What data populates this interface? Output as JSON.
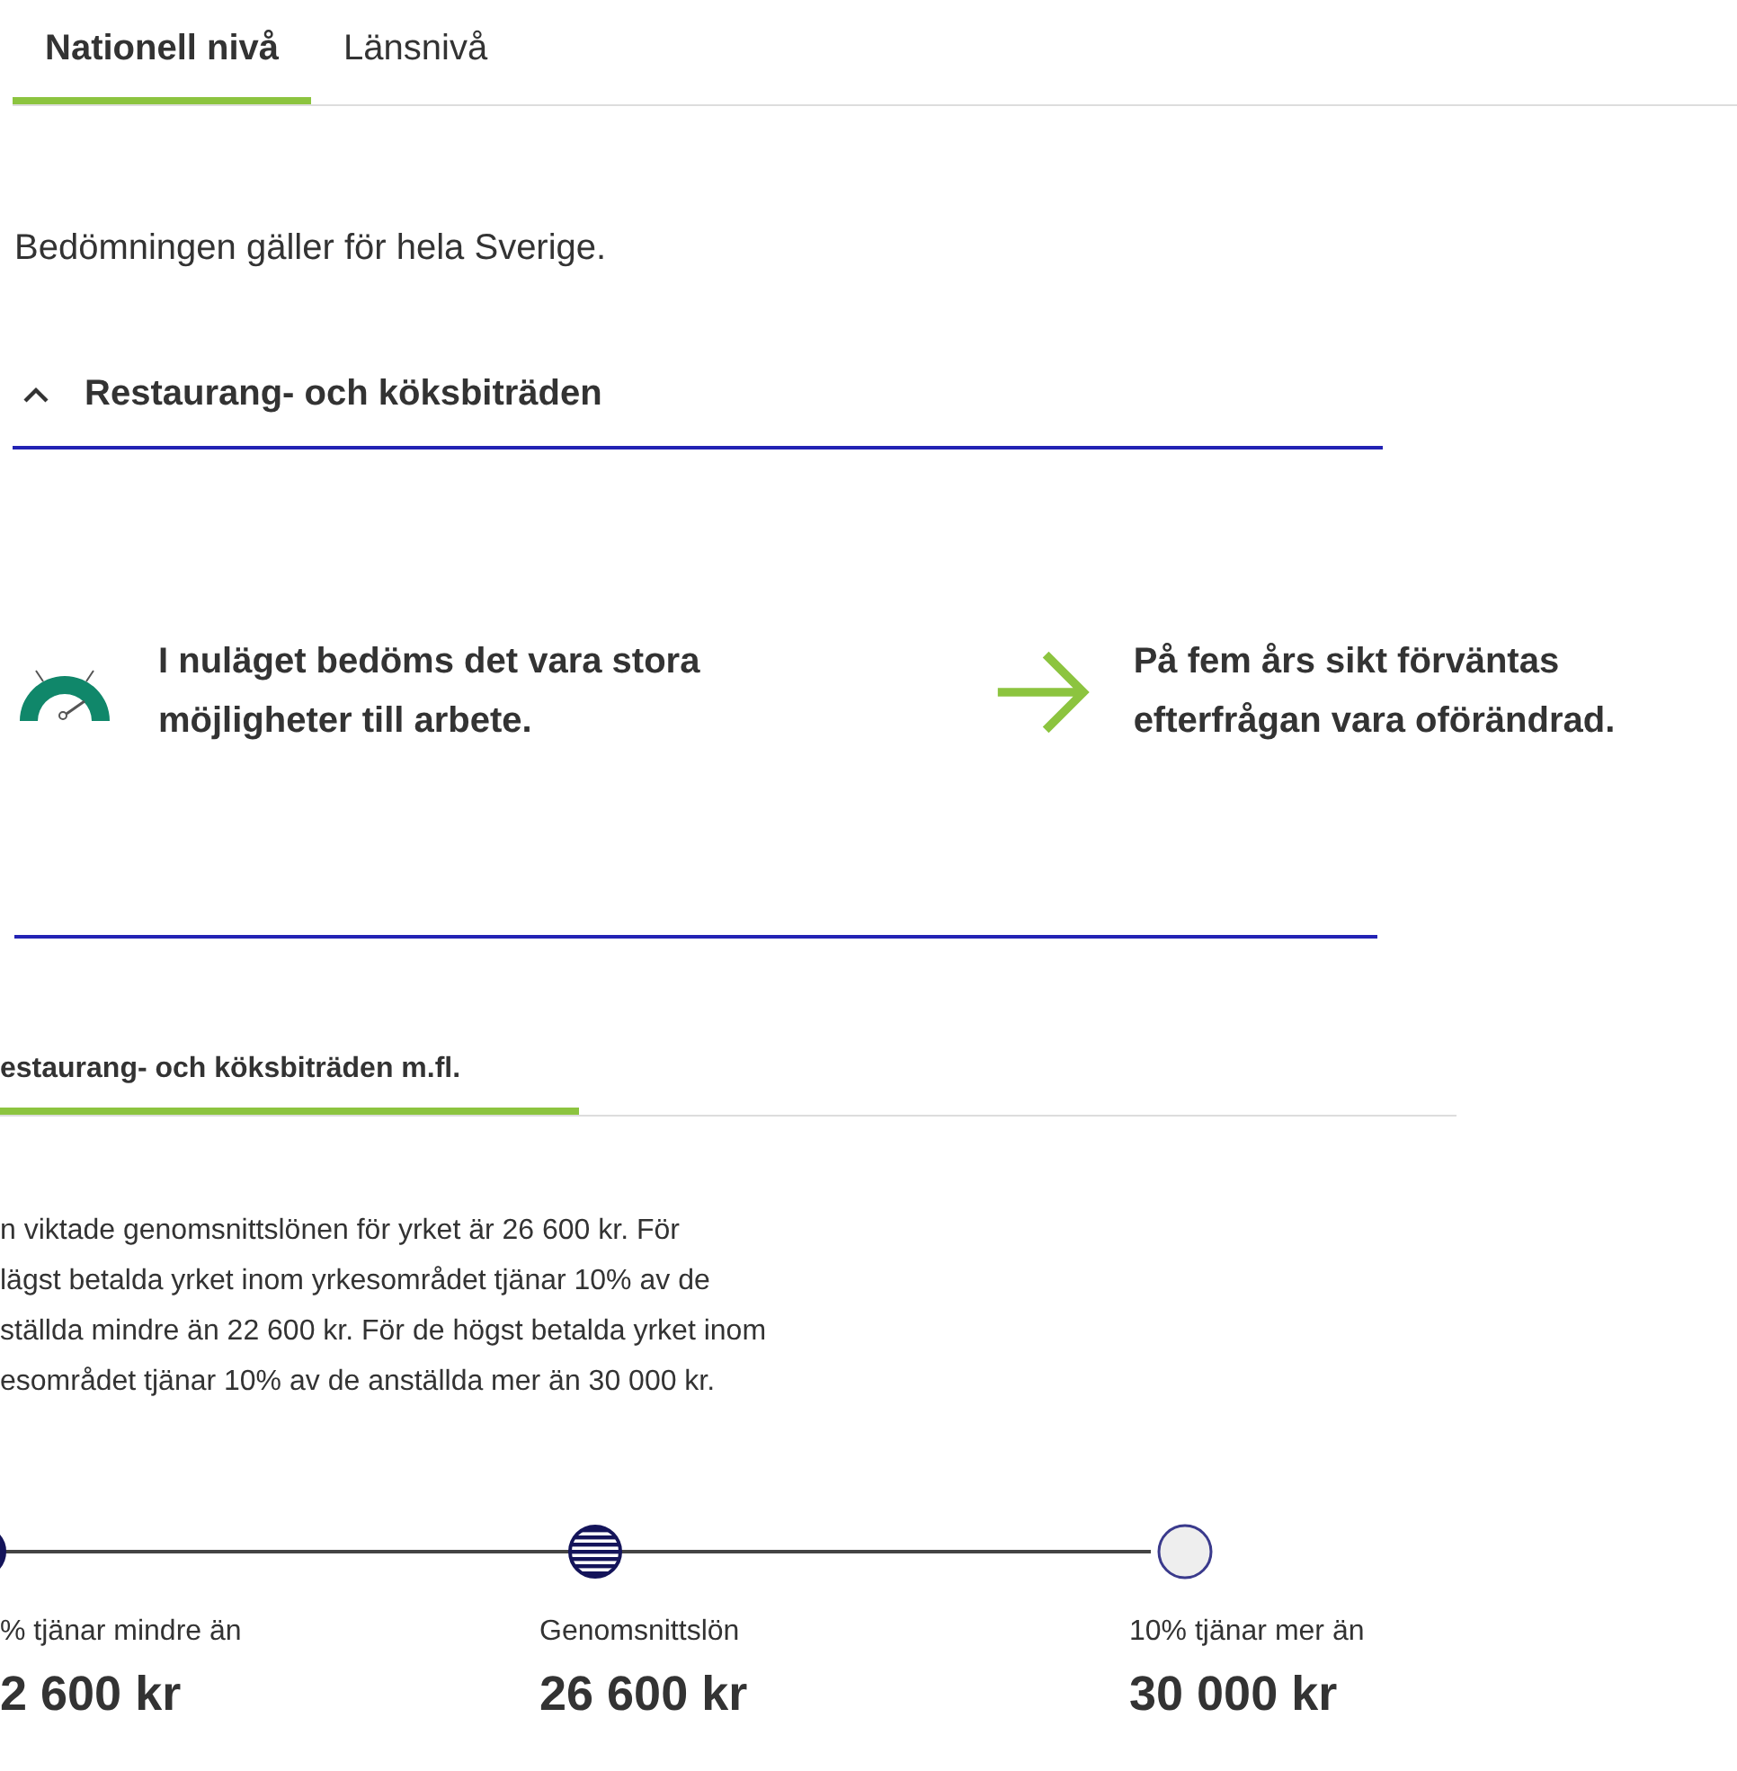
{
  "tabs": [
    {
      "label": "Nationell nivå",
      "selected": true
    },
    {
      "label": "Länsnivå",
      "selected": false
    }
  ],
  "intro": "Bedömningen gäller för hela Sverige.",
  "accordion": {
    "title": "Restaurang- och köksbiträden",
    "expanded": true
  },
  "assessments": [
    {
      "kind": "gauge",
      "text": "I nuläget bedöms det vara stora möjligheter till arbete."
    },
    {
      "kind": "trend",
      "text": "På fem års sikt förväntas efterfrågan vara oförändrad."
    }
  ],
  "salary": {
    "tabs": [
      {
        "label": "estaurang- och köksbiträden m.fl.",
        "selected": true
      }
    ],
    "paragraph_lines": [
      "n viktade genomsnittslönen för yrket är 26 600 kr. För",
      "lägst betalda yrket inom yrkesområdet tjänar 10% av de",
      "ställda mindre än 22 600 kr. För de högst betalda yrket inom",
      "esområdet tjänar 10% av de anställda mer än 30 000 kr."
    ],
    "points": [
      {
        "kind": "solid",
        "label": "% tjänar mindre än",
        "value": "2 600 kr"
      },
      {
        "kind": "striped",
        "label": "Genomsnittslön",
        "value": "26 600 kr"
      },
      {
        "kind": "hollow",
        "label": "10% tjänar mer än",
        "value": "30 000 kr"
      }
    ]
  }
}
